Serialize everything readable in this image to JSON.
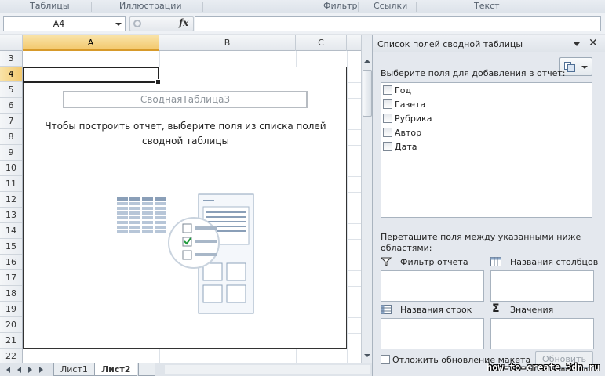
{
  "ribbon": {
    "groups": [
      "Таблицы",
      "Иллюстрации",
      "Фильтр",
      "Ссылки",
      "Текст"
    ]
  },
  "formula_bar": {
    "name_box": "A4",
    "fx_label": "fx",
    "value": ""
  },
  "grid": {
    "columns": [
      "A",
      "B",
      "C"
    ],
    "rows": [
      "3",
      "4",
      "5",
      "6",
      "7",
      "8",
      "9",
      "10",
      "11",
      "12",
      "13",
      "14",
      "15",
      "16",
      "17",
      "18",
      "19",
      "20",
      "21",
      "22"
    ],
    "selected_cell": "A4"
  },
  "pivot_placeholder": {
    "name": "СводнаяТаблица3",
    "hint": "Чтобы построить отчет, выберите поля из списка полей сводной таблицы"
  },
  "sheet_tabs": {
    "tabs": [
      "Лист1",
      "Лист2"
    ],
    "active": "Лист2"
  },
  "field_list": {
    "title": "Список полей сводной таблицы",
    "choose_label": "Выберите поля для добавления в отчет:",
    "fields": [
      {
        "label": "Год",
        "checked": false
      },
      {
        "label": "Газета",
        "checked": false
      },
      {
        "label": "Рубрика",
        "checked": false
      },
      {
        "label": "Автор",
        "checked": false
      },
      {
        "label": "Дата",
        "checked": false
      }
    ],
    "drag_label": "Перетащите поля между указанными ниже областями:",
    "areas": {
      "report_filter": "Фильтр отчета",
      "column_labels": "Названия столбцов",
      "row_labels": "Названия строк",
      "values": "Значения"
    },
    "defer_label": "Отложить обновление макета",
    "update_button": "Обновить"
  },
  "watermark": "how-to-create.3dn.ru"
}
